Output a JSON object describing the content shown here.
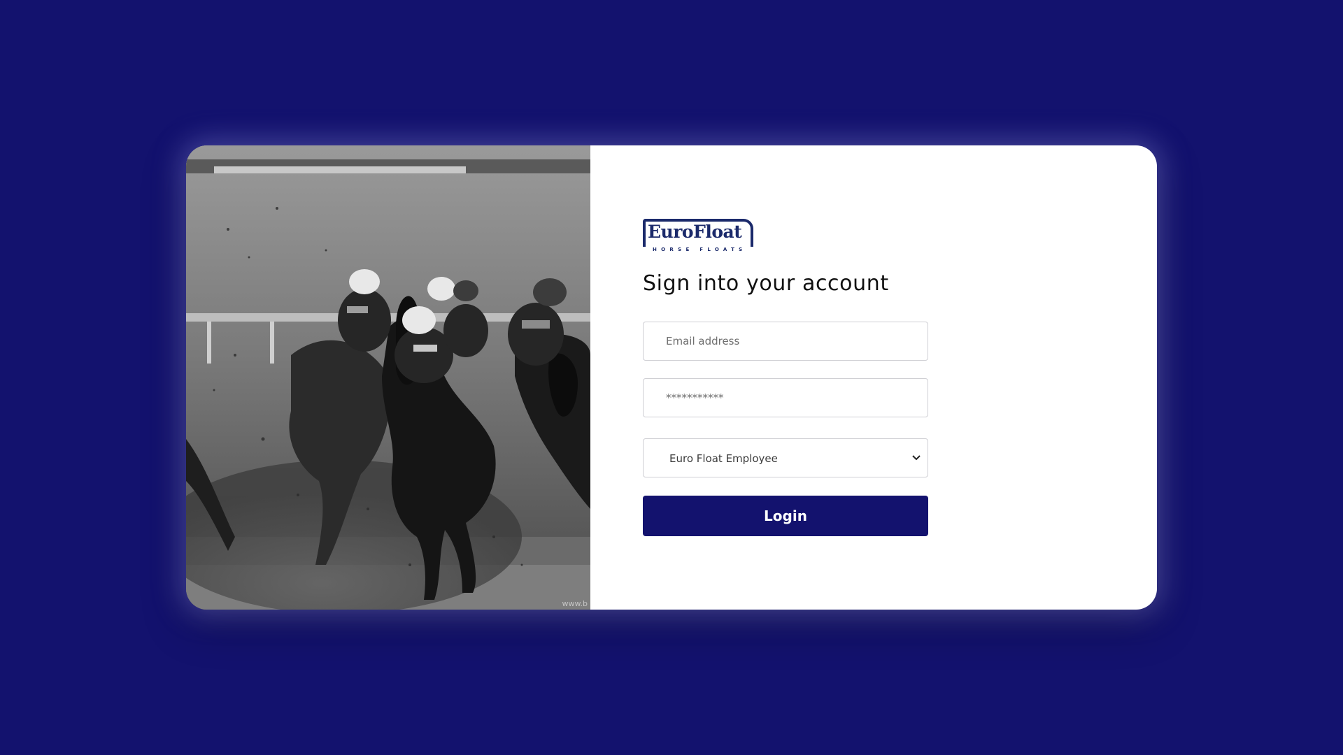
{
  "colors": {
    "background": "#13126e",
    "card": "#ffffff",
    "brand": "#1b2a6b",
    "button": "#13126e",
    "button_text": "#ffffff"
  },
  "hero": {
    "image_description_icon": "horse-racing-photo",
    "watermark": "www.b"
  },
  "logo": {
    "name": "EuroFloat",
    "tagline": "HORSE FLOATS"
  },
  "login": {
    "heading": "Sign into your account",
    "email_placeholder": "Email address",
    "password_placeholder": "***********",
    "role_selected": "Euro Float Employee",
    "submit_label": "Login"
  }
}
